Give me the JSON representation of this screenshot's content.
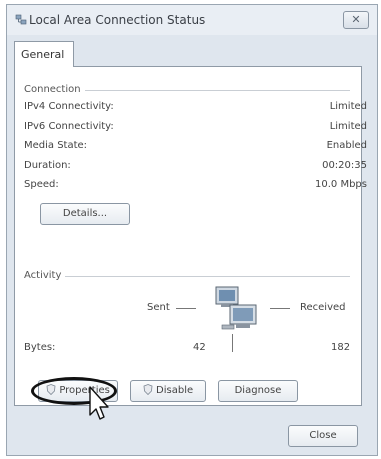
{
  "window": {
    "title": "Local Area Connection Status",
    "close_glyph": "✕"
  },
  "tabs": [
    {
      "label": "General"
    }
  ],
  "connection": {
    "heading": "Connection",
    "rows": [
      {
        "label": "IPv4 Connectivity:",
        "value": "Limited"
      },
      {
        "label": "IPv6 Connectivity:",
        "value": "Limited"
      },
      {
        "label": "Media State:",
        "value": "Enabled"
      },
      {
        "label": "Duration:",
        "value": "00:20:35"
      },
      {
        "label": "Speed:",
        "value": "10.0 Mbps"
      }
    ],
    "details_button": "Details..."
  },
  "activity": {
    "heading": "Activity",
    "sent_label": "Sent",
    "received_label": "Received",
    "bytes_label": "Bytes:",
    "bytes_sent": "42",
    "bytes_received": "182",
    "icon": "network-computers-icon"
  },
  "actions": {
    "properties_button": "Properties",
    "disable_button": "Disable",
    "diagnose_button": "Diagnose",
    "shield_icon": "uac-shield-icon"
  },
  "footer": {
    "close_button": "Close"
  },
  "colors": {
    "window_bg": "#dfe6ee",
    "panel_bg": "#ffffff",
    "highlight_ring": "#111111"
  }
}
